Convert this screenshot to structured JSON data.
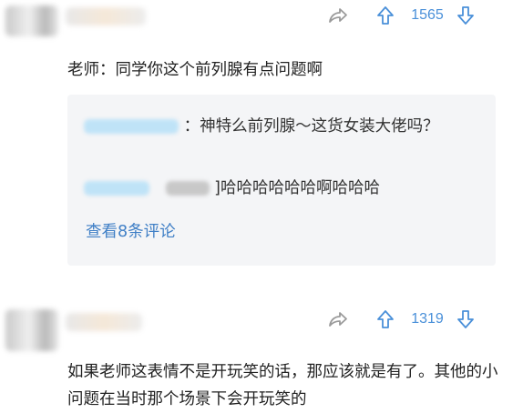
{
  "comments": [
    {
      "upvotes": "1565",
      "text": "老师：同学你这个前列腺有点问题啊",
      "replies": [
        {
          "text": "：神特么前列腺～这货女装大佬吗？"
        },
        {
          "text": "]哈哈哈哈哈哈啊哈哈哈"
        }
      ],
      "more_label": "查看8条评论"
    },
    {
      "upvotes": "1319",
      "text": "如果老师这表情不是开玩笑的话，那应该就是有了。其他的小问题在当时那个场景下会开玩笑的"
    }
  ],
  "colors": {
    "accent": "#4a90d9",
    "link": "#3f7fc6",
    "reply_bg": "#f4f5f7",
    "text": "#222222"
  },
  "icons": {
    "share": "share-arrow-icon",
    "upvote": "upvote-arrow-icon",
    "downvote": "downvote-arrow-icon"
  }
}
